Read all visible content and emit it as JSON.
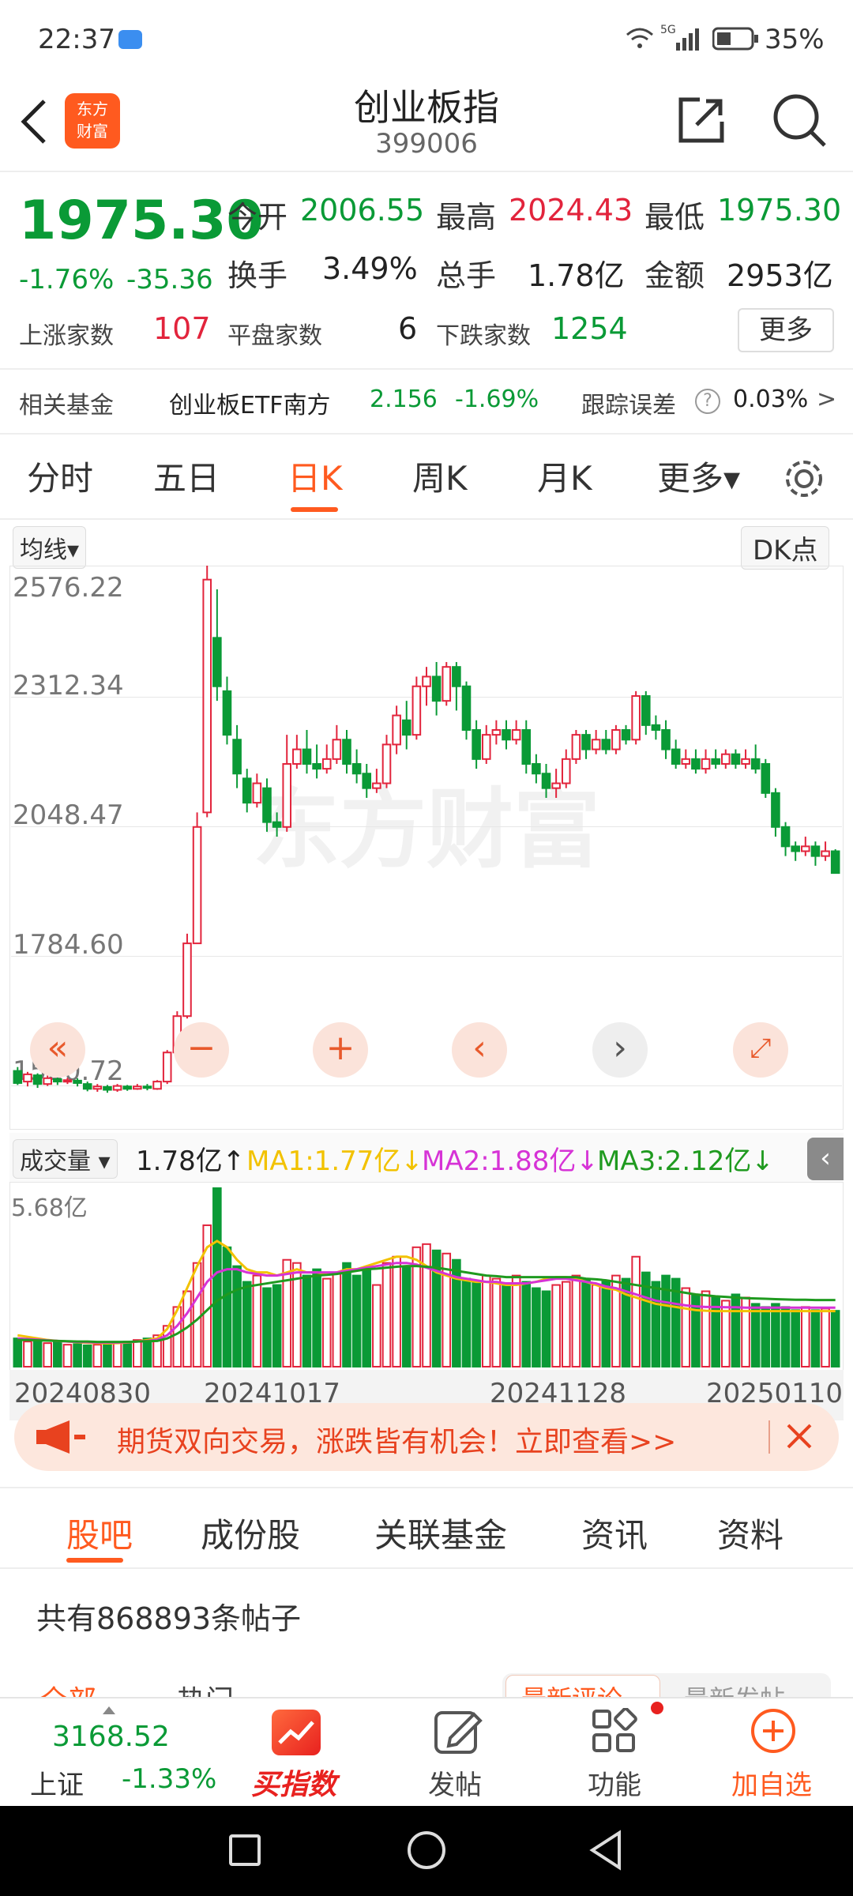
{
  "status": {
    "time": "22:37",
    "battery": "35%",
    "network": "5G"
  },
  "nav": {
    "title": "创业板指",
    "code": "399006"
  },
  "quote": {
    "price": "1975.30",
    "change_pct": "-1.76%",
    "change": "-35.36",
    "open_label": "今开",
    "open": "2006.55",
    "high_label": "最高",
    "high": "2024.43",
    "low_label": "最低",
    "low": "1975.30",
    "turnover_label": "换手",
    "turnover": "3.49%",
    "volume_label": "总手",
    "volume": "1.78亿",
    "amount_label": "金额",
    "amount": "2953亿",
    "up_label": "上涨家数",
    "up": "107",
    "flat_label": "平盘家数",
    "flat": "6",
    "down_label": "下跌家数",
    "down": "1254",
    "more": "更多"
  },
  "fund": {
    "label": "相关基金",
    "name": "创业板ETF南方",
    "price": "2.156",
    "pct": "-1.69%",
    "err_label": "跟踪误差",
    "help": "?",
    "err": "0.03%",
    "arrow": ">"
  },
  "tabs": [
    "分时",
    "五日",
    "日K",
    "周K",
    "月K",
    "更多▾"
  ],
  "chart": {
    "ma_select": "均线▾",
    "dk": "DK点",
    "price_labels": [
      "2576.22",
      "2312.34",
      "2048.47",
      "1784.60",
      "1520.72"
    ],
    "vol_select": "成交量 ▾",
    "vol_now": "1.78亿↑",
    "ma1": "MA1:1.77亿↓",
    "ma2": "MA2:1.88亿↓",
    "ma3": "MA3:2.12亿↓",
    "vol_max": "5.68亿",
    "dates": [
      "20240830",
      "20241017",
      "20241128",
      "20250110"
    ],
    "watermark": "东方财富"
  },
  "chart_data": {
    "type": "candlestick",
    "ylim": [
      1520.72,
      2576.22
    ],
    "candles": [
      [
        1567,
        1542,
        1575,
        1538
      ],
      [
        1545,
        1560,
        1565,
        1535
      ],
      [
        1558,
        1540,
        1562,
        1532
      ],
      [
        1540,
        1552,
        1558,
        1536
      ],
      [
        1550,
        1545,
        1556,
        1538
      ],
      [
        1545,
        1548,
        1553,
        1540
      ],
      [
        1547,
        1542,
        1552,
        1535
      ],
      [
        1540,
        1530,
        1545,
        1525
      ],
      [
        1530,
        1535,
        1540,
        1524
      ],
      [
        1534,
        1528,
        1538,
        1522
      ],
      [
        1528,
        1536,
        1540,
        1524
      ],
      [
        1535,
        1530,
        1538,
        1526
      ],
      [
        1530,
        1535,
        1540,
        1528
      ],
      [
        1535,
        1532,
        1540,
        1527
      ],
      [
        1530,
        1545,
        1548,
        1528
      ],
      [
        1545,
        1605,
        1610,
        1540
      ],
      [
        1605,
        1680,
        1690,
        1600
      ],
      [
        1680,
        1830,
        1850,
        1675
      ],
      [
        1830,
        2070,
        2100,
        1830
      ],
      [
        2100,
        2580,
        2620,
        2090
      ],
      [
        2460,
        2360,
        2560,
        2330
      ],
      [
        2350,
        2260,
        2380,
        2240
      ],
      [
        2250,
        2180,
        2280,
        2150
      ],
      [
        2170,
        2120,
        2190,
        2100
      ],
      [
        2120,
        2160,
        2180,
        2110
      ],
      [
        2150,
        2080,
        2170,
        2060
      ],
      [
        2080,
        2070,
        2100,
        2050
      ],
      [
        2070,
        2200,
        2260,
        2060
      ],
      [
        2200,
        2230,
        2260,
        2190
      ],
      [
        2230,
        2200,
        2270,
        2180
      ],
      [
        2200,
        2190,
        2240,
        2170
      ],
      [
        2190,
        2210,
        2240,
        2180
      ],
      [
        2210,
        2250,
        2280,
        2200
      ],
      [
        2250,
        2200,
        2270,
        2180
      ],
      [
        2200,
        2180,
        2230,
        2160
      ],
      [
        2180,
        2150,
        2200,
        2130
      ],
      [
        2150,
        2160,
        2190,
        2140
      ],
      [
        2160,
        2240,
        2260,
        2150
      ],
      [
        2240,
        2300,
        2320,
        2220
      ],
      [
        2290,
        2260,
        2330,
        2230
      ],
      [
        2260,
        2360,
        2380,
        2250
      ],
      [
        2360,
        2380,
        2400,
        2320
      ],
      [
        2380,
        2330,
        2410,
        2300
      ],
      [
        2330,
        2400,
        2410,
        2320
      ],
      [
        2400,
        2360,
        2410,
        2310
      ],
      [
        2360,
        2270,
        2370,
        2250
      ],
      [
        2270,
        2210,
        2290,
        2190
      ],
      [
        2210,
        2260,
        2280,
        2200
      ],
      [
        2260,
        2270,
        2290,
        2240
      ],
      [
        2270,
        2250,
        2290,
        2230
      ],
      [
        2250,
        2270,
        2290,
        2240
      ],
      [
        2270,
        2200,
        2290,
        2180
      ],
      [
        2200,
        2180,
        2220,
        2160
      ],
      [
        2180,
        2150,
        2200,
        2130
      ],
      [
        2150,
        2160,
        2190,
        2130
      ],
      [
        2160,
        2210,
        2230,
        2150
      ],
      [
        2210,
        2260,
        2270,
        2200
      ],
      [
        2260,
        2230,
        2270,
        2210
      ],
      [
        2230,
        2250,
        2270,
        2220
      ],
      [
        2250,
        2230,
        2270,
        2220
      ],
      [
        2230,
        2270,
        2280,
        2220
      ],
      [
        2270,
        2250,
        2280,
        2240
      ],
      [
        2250,
        2340,
        2350,
        2240
      ],
      [
        2340,
        2280,
        2350,
        2260
      ],
      [
        2280,
        2270,
        2300,
        2250
      ],
      [
        2270,
        2230,
        2290,
        2210
      ],
      [
        2230,
        2200,
        2250,
        2190
      ],
      [
        2200,
        2210,
        2230,
        2190
      ],
      [
        2210,
        2190,
        2230,
        2180
      ],
      [
        2190,
        2210,
        2230,
        2180
      ],
      [
        2210,
        2200,
        2230,
        2190
      ],
      [
        2200,
        2220,
        2230,
        2190
      ],
      [
        2220,
        2200,
        2230,
        2190
      ],
      [
        2200,
        2210,
        2230,
        2190
      ],
      [
        2210,
        2190,
        2240,
        2180
      ],
      [
        2200,
        2140,
        2210,
        2130
      ],
      [
        2140,
        2070,
        2150,
        2050
      ],
      [
        2070,
        2030,
        2080,
        2010
      ],
      [
        2030,
        2020,
        2040,
        2000
      ],
      [
        2020,
        2030,
        2050,
        2010
      ],
      [
        2030,
        2010,
        2040,
        1990
      ],
      [
        2010,
        2020,
        2040,
        2000
      ],
      [
        2020,
        1975,
        2024,
        1975
      ]
    ],
    "volume_ylim": [
      0,
      5.68
    ],
    "volumes": [
      0.9,
      0.8,
      0.85,
      0.75,
      0.8,
      0.7,
      0.72,
      0.68,
      0.7,
      0.74,
      0.76,
      0.8,
      0.85,
      0.9,
      1.0,
      1.3,
      1.9,
      2.4,
      3.3,
      4.5,
      5.68,
      3.8,
      3.2,
      2.7,
      2.9,
      2.5,
      2.6,
      3.4,
      3.3,
      2.9,
      3.1,
      2.8,
      3.0,
      3.3,
      2.9,
      3.1,
      2.6,
      3.3,
      3.5,
      3.2,
      3.8,
      3.9,
      3.7,
      3.6,
      3.4,
      2.8,
      2.7,
      2.9,
      2.8,
      2.6,
      2.9,
      2.7,
      2.5,
      2.4,
      2.6,
      2.7,
      2.9,
      2.8,
      2.6,
      2.7,
      2.9,
      2.8,
      3.5,
      3.0,
      2.7,
      2.9,
      2.8,
      2.5,
      2.3,
      2.4,
      2.2,
      2.1,
      2.3,
      2.2,
      2.0,
      1.9,
      2.0,
      1.9,
      1.8,
      1.9,
      1.8,
      1.85,
      1.78
    ],
    "ma_series": [
      {
        "name": "MA1",
        "color": "#f2c200",
        "values": [
          1.0,
          0.95,
          0.9,
          0.85,
          0.82,
          0.8,
          0.78,
          0.76,
          0.75,
          0.74,
          0.75,
          0.77,
          0.8,
          0.85,
          0.9,
          1.2,
          1.8,
          2.5,
          3.2,
          3.8,
          4.0,
          3.8,
          3.4,
          3.1,
          3.0,
          3.0,
          2.9,
          3.0,
          3.1,
          3.0,
          3.0,
          2.95,
          3.0,
          3.1,
          3.1,
          3.2,
          3.3,
          3.4,
          3.5,
          3.5,
          3.4,
          3.2,
          3.0,
          2.9,
          2.8,
          2.75,
          2.7,
          2.7,
          2.65,
          2.6,
          2.6,
          2.65,
          2.7,
          2.8,
          2.85,
          2.85,
          2.8,
          2.7,
          2.6,
          2.5,
          2.45,
          2.3,
          2.2,
          2.1,
          2.0,
          1.95,
          1.9,
          1.85,
          1.8,
          1.78,
          1.77,
          1.77,
          1.77,
          1.77,
          1.77,
          1.77,
          1.77,
          1.77,
          1.77,
          1.77,
          1.77,
          1.77,
          1.77
        ]
      },
      {
        "name": "MA2",
        "color": "#d633d6",
        "values": [
          0.9,
          0.88,
          0.86,
          0.84,
          0.82,
          0.8,
          0.79,
          0.78,
          0.77,
          0.77,
          0.77,
          0.78,
          0.8,
          0.82,
          0.86,
          1.0,
          1.3,
          1.7,
          2.2,
          2.7,
          3.0,
          3.1,
          3.1,
          3.0,
          2.95,
          2.9,
          2.9,
          2.95,
          3.0,
          3.0,
          3.0,
          3.0,
          3.0,
          3.05,
          3.1,
          3.15,
          3.2,
          3.25,
          3.3,
          3.3,
          3.25,
          3.15,
          3.05,
          2.95,
          2.85,
          2.8,
          2.75,
          2.7,
          2.7,
          2.65,
          2.65,
          2.65,
          2.7,
          2.75,
          2.8,
          2.8,
          2.75,
          2.7,
          2.65,
          2.55,
          2.5,
          2.4,
          2.3,
          2.2,
          2.1,
          2.05,
          2.0,
          1.95,
          1.92,
          1.9,
          1.9,
          1.89,
          1.89,
          1.88,
          1.88,
          1.88,
          1.88,
          1.88,
          1.88,
          1.88,
          1.88,
          1.88,
          1.88
        ]
      },
      {
        "name": "MA3",
        "color": "#1f9a1f",
        "values": [
          0.85,
          0.85,
          0.84,
          0.83,
          0.82,
          0.81,
          0.8,
          0.8,
          0.79,
          0.79,
          0.79,
          0.79,
          0.8,
          0.81,
          0.82,
          0.9,
          1.05,
          1.25,
          1.5,
          1.8,
          2.1,
          2.3,
          2.45,
          2.55,
          2.6,
          2.65,
          2.7,
          2.75,
          2.8,
          2.85,
          2.9,
          2.92,
          2.95,
          3.0,
          3.05,
          3.1,
          3.12,
          3.15,
          3.18,
          3.2,
          3.2,
          3.18,
          3.15,
          3.1,
          3.05,
          3.0,
          2.95,
          2.9,
          2.88,
          2.85,
          2.85,
          2.85,
          2.85,
          2.85,
          2.85,
          2.85,
          2.85,
          2.8,
          2.78,
          2.75,
          2.7,
          2.65,
          2.6,
          2.55,
          2.5,
          2.45,
          2.4,
          2.35,
          2.3,
          2.27,
          2.24,
          2.22,
          2.2,
          2.18,
          2.17,
          2.16,
          2.15,
          2.14,
          2.13,
          2.13,
          2.12,
          2.12,
          2.12
        ]
      }
    ]
  },
  "banner": {
    "text": "期货双向交易，涨跌皆有机会！立即查看>>"
  },
  "subtabs": [
    "股吧",
    "成份股",
    "关联基金",
    "资讯",
    "资料"
  ],
  "posts": {
    "count_text": "共有868893条帖子",
    "filter_all": "全部",
    "filter_hot": "热门",
    "sort_reply": "最新评论",
    "sort_post": "最新发帖"
  },
  "bottom": {
    "index_value": "3168.52",
    "index_name": "上证",
    "index_pct": "-1.33%",
    "buy": "买指数",
    "post": "发帖",
    "func": "功能",
    "add": "加自选"
  },
  "colors": {
    "up": "#e2243c",
    "down": "#0a9a36",
    "accent": "#ff5a1f"
  }
}
